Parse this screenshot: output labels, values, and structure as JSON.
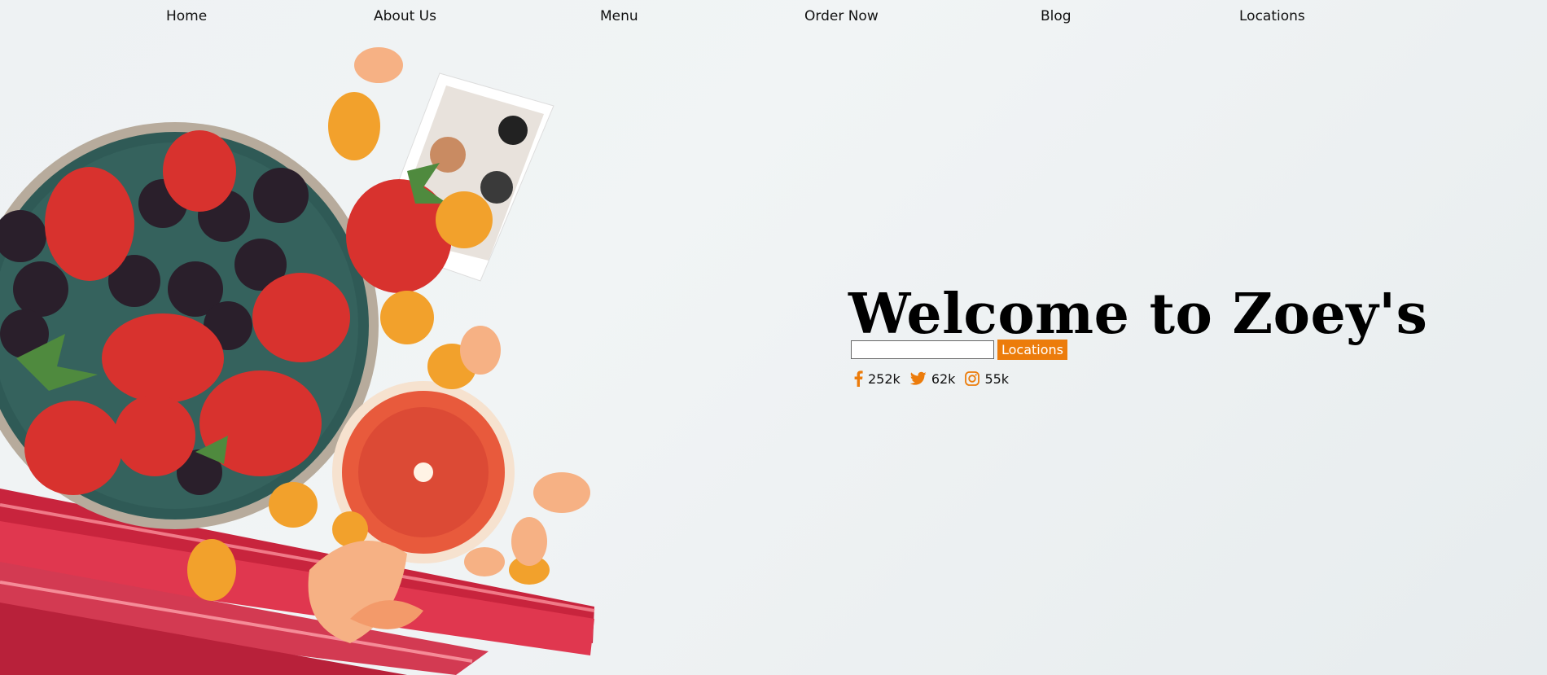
{
  "nav": {
    "items": [
      {
        "label": "Home"
      },
      {
        "label": "About Us"
      },
      {
        "label": "Menu"
      },
      {
        "label": "Order Now"
      },
      {
        "label": "Blog"
      },
      {
        "label": "Locations"
      }
    ]
  },
  "hero": {
    "title": "Welcome to Zoey's",
    "search": {
      "value": "",
      "placeholder": ""
    },
    "locations_button": "Locations"
  },
  "social": {
    "facebook": {
      "icon": "facebook-icon",
      "count": "252k"
    },
    "twitter": {
      "icon": "twitter-icon",
      "count": "62k"
    },
    "instagram": {
      "icon": "instagram-icon",
      "count": "55k"
    }
  },
  "colors": {
    "accent": "#ec7c0b",
    "background": "#eef2f3"
  }
}
